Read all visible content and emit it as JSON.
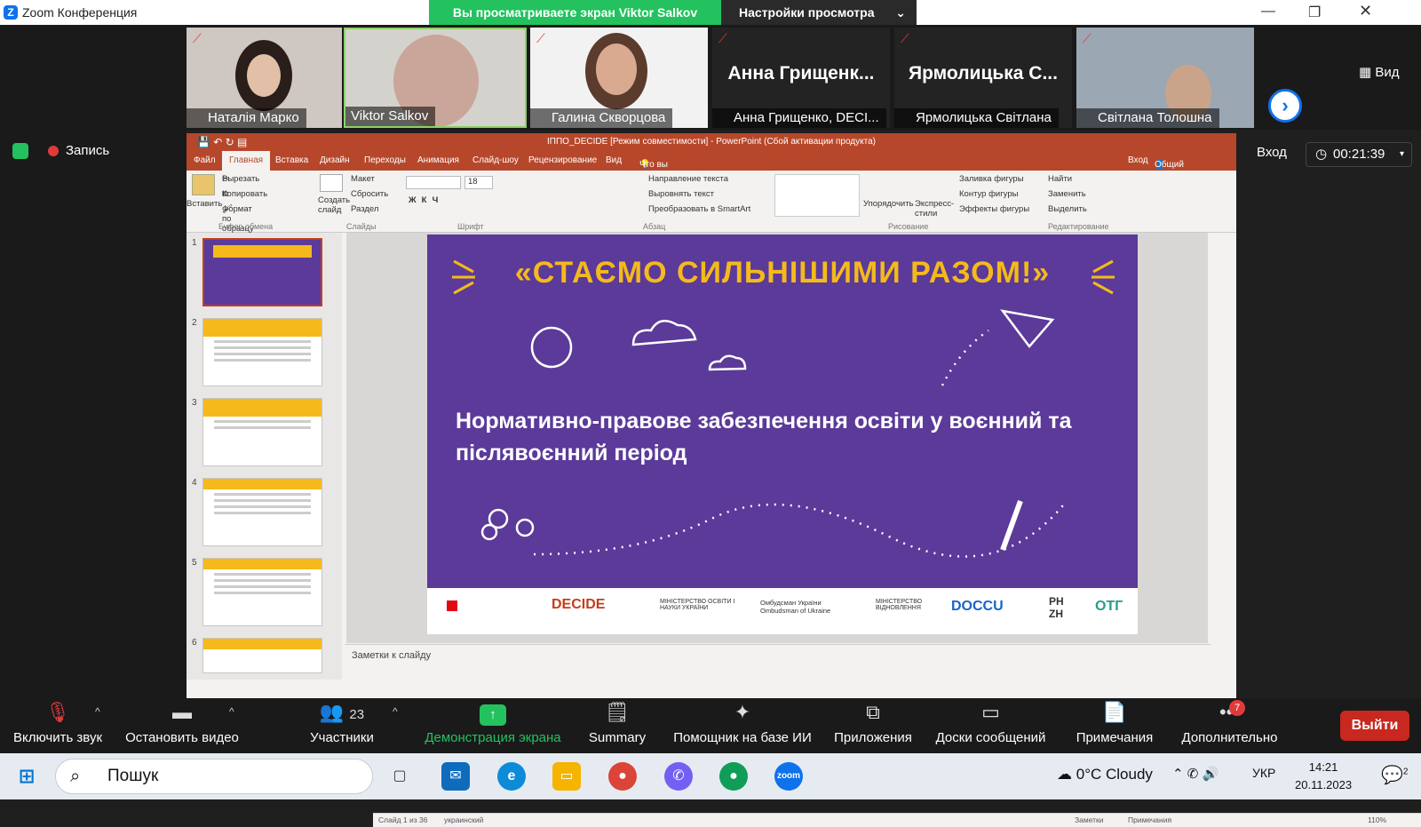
{
  "window": {
    "title": "Zoom Конференция",
    "share_banner": "Вы просматриваете экран Viktor Salkov",
    "view_settings": "Настройки просмотра"
  },
  "participants": [
    {
      "name": "Наталія Марко",
      "muted": true
    },
    {
      "name": "Viktor Salkov",
      "muted": false
    },
    {
      "name": "Галина Скворцова",
      "muted": true
    },
    {
      "name": "Анна Грищенко, DECI...",
      "display": "Анна Грищенк...",
      "muted": true
    },
    {
      "name": "Ярмолицька Світлана",
      "display": "Ярмолицька С...",
      "muted": true
    },
    {
      "name": "Світлана Толошна",
      "muted": true
    }
  ],
  "view_button": "Вид",
  "recording": "Запись",
  "signin": "Вход",
  "timer": "00:21:39",
  "powerpoint": {
    "title": "ІППО_DECIDE [Режим совместимости] - PowerPoint (Сбой активации продукта)",
    "tabs": [
      "Файл",
      "Главная",
      "Вставка",
      "Дизайн",
      "Переходы",
      "Анимация",
      "Слайд-шоу",
      "Рецензирование",
      "Вид"
    ],
    "tell_me": "Что вы хотите сделать?",
    "signin": "Вход",
    "share": "Общий доступ",
    "ribbon": {
      "paste": "Вставить",
      "cut": "Вырезать",
      "copy": "Копировать",
      "format_painter": "Формат по образцу",
      "new_slide": "Создать слайд",
      "layout": "Макет",
      "reset": "Сбросить",
      "section": "Раздел",
      "font_size": "18",
      "text_direction": "Направление текста",
      "align_text": "Выровнять текст",
      "smartart": "Преобразовать в SmartArt",
      "arrange": "Упорядочить",
      "quick_styles": "Экспресс-стили",
      "shape_fill": "Заливка фигуры",
      "shape_outline": "Контур фигуры",
      "shape_effects": "Эффекты фигуры",
      "find": "Найти",
      "replace": "Заменить",
      "select": "Выделить",
      "groups": [
        "Буфер обмена",
        "Слайды",
        "Шрифт",
        "Абзац",
        "Рисование",
        "Редактирование"
      ]
    },
    "slide": {
      "headline": "«СТАЄМО СИЛЬНІШИМИ РАЗОМ!»",
      "subtitle": "Нормативно-правове забезпечення освіти у воєнний та післявоєнний період",
      "logos": [
        "DECIDE",
        "МІНІСТЕРСТВО ОСВІТИ І НАУКИ УКРАЇНИ",
        "Омбудсман України Ombudsman of Ukraine",
        "МІНІСТЕРСТВО ВІДНОВЛЕННЯ",
        "DOCCU",
        "PH ZH",
        "ОТГ"
      ]
    },
    "thumbnails": [
      "1",
      "2",
      "3",
      "4",
      "5",
      "6"
    ],
    "notes_placeholder": "Заметки к слайду",
    "status": {
      "slide": "Слайд 1 из 36",
      "lang": "украинский",
      "notes": "Заметки",
      "comments": "Примечания",
      "zoom": "110%"
    }
  },
  "toolbar": [
    {
      "label": "Включить звук"
    },
    {
      "label": "Остановить видео"
    },
    {
      "label": "Участники",
      "count": "23"
    },
    {
      "label": "Демонстрация экрана"
    },
    {
      "label": "Summary"
    },
    {
      "label": "Помощник на базе ИИ"
    },
    {
      "label": "Приложения"
    },
    {
      "label": "Доски сообщений"
    },
    {
      "label": "Примечания"
    },
    {
      "label": "Дополнительно",
      "badge": "7"
    }
  ],
  "exit": "Выйти",
  "taskbar": {
    "search": "Пошук",
    "weather": "0°C  Cloudy",
    "lang": "УКР",
    "time": "14:21",
    "date": "20.11.2023",
    "notif": "2"
  },
  "colors": {
    "zoom_blue": "#0e72ed",
    "share_green": "#23c25e",
    "ppt_red": "#b7472a",
    "slide_purple": "#5b3a99",
    "slide_yellow": "#f5b91c",
    "exit_red": "#c8281f"
  }
}
